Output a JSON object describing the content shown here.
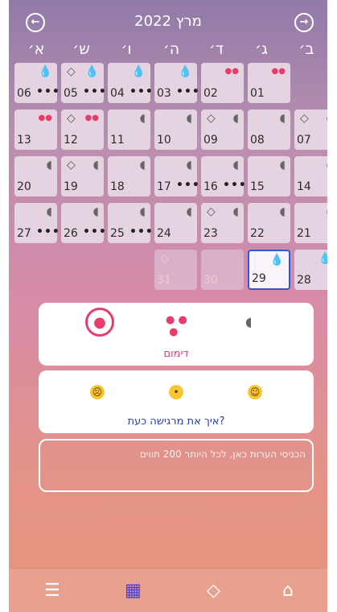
{
  "header": {
    "title": "מרץ 2022",
    "prev_icon": "arrow-left-circle-icon",
    "next_icon": "arrow-right-circle-icon"
  },
  "weekdays": [
    "א׳",
    "ש׳",
    "ו׳",
    "ה׳",
    "ד׳",
    "ג׳",
    "ב׳"
  ],
  "calendar": {
    "rows": [
      [
        "06",
        "05",
        "04",
        "03",
        "02",
        "01",
        ""
      ],
      [
        "13",
        "12",
        "11",
        "10",
        "09",
        "08",
        "07"
      ],
      [
        "20",
        "19",
        "18",
        "17",
        "16",
        "15",
        "14"
      ],
      [
        "27",
        "26",
        "25",
        "24",
        "23",
        "22",
        "21"
      ],
      [
        "",
        "",
        "",
        "31",
        "30",
        "29",
        "28"
      ]
    ],
    "notes_dots": "•••"
  },
  "flow_panel": {
    "label": "דימום",
    "options": [
      "heavy-drop-icon",
      "medium-drops-icon",
      "no-flow-icon"
    ]
  },
  "mood_panel": {
    "label": "איך את מרגישה כעת?",
    "options": [
      "sad-face-icon",
      "neutral-face-icon",
      "happy-face-icon"
    ]
  },
  "notes": {
    "placeholder": "הכניסי הערות כאן, לכל היותר 200 תווים",
    "value": ""
  },
  "nav": {
    "items": [
      "menu-icon",
      "calendar-icon",
      "diamond-icon",
      "home-icon"
    ]
  },
  "colors": {
    "accent": "#e73c6c",
    "today_border": "#2f58d6",
    "link": "#1f3fae"
  }
}
